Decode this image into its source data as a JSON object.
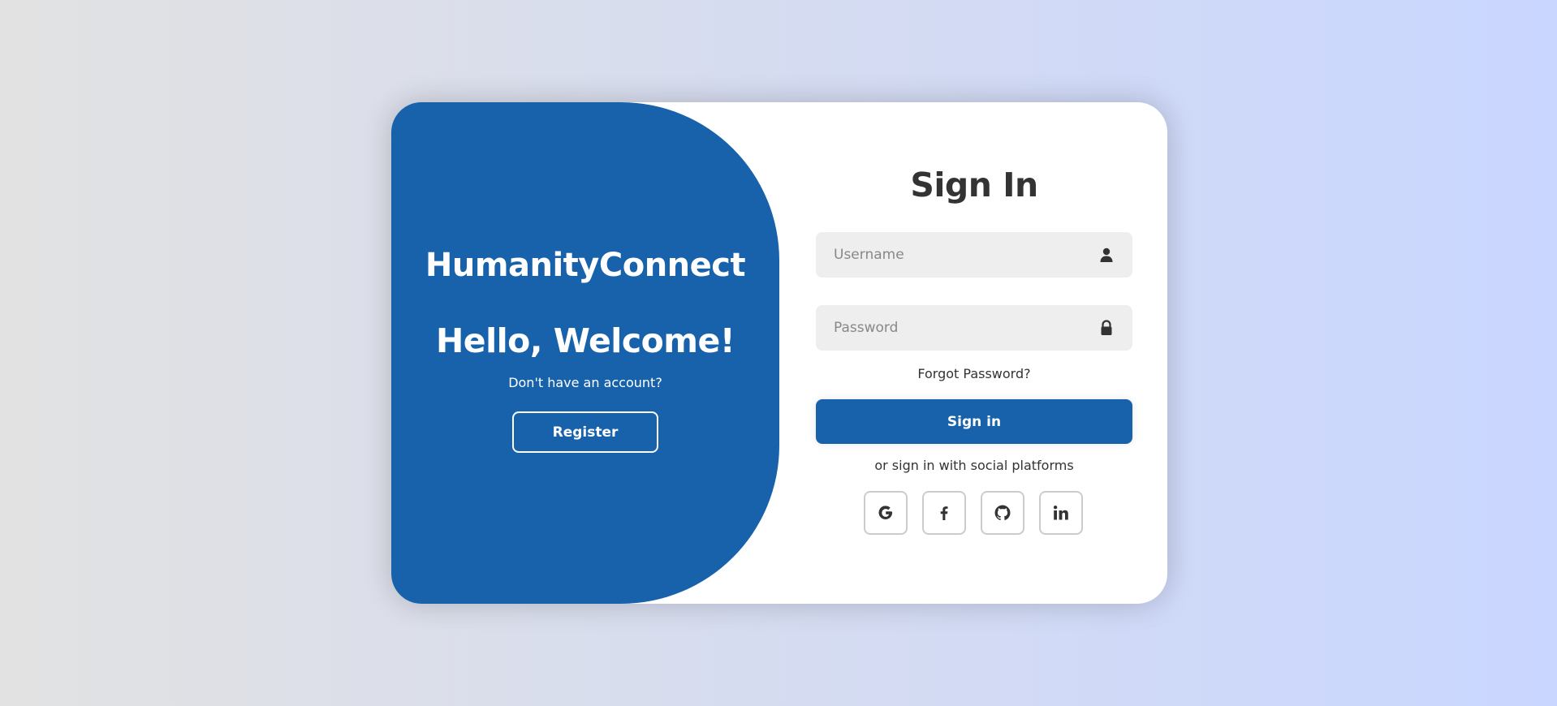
{
  "welcome_panel": {
    "brand": "HumanityConnect",
    "greeting": "Hello, Welcome!",
    "subtext": "Don't have an account?",
    "register_label": "Register"
  },
  "signin_form": {
    "title": "Sign In",
    "username": {
      "placeholder": "Username",
      "value": "",
      "icon": "user-icon"
    },
    "password": {
      "placeholder": "Password",
      "value": "",
      "icon": "lock-icon"
    },
    "forgot_label": "Forgot Password?",
    "submit_label": "Sign in",
    "social_text": "or sign in with social platforms",
    "social_icons": [
      "google-icon",
      "facebook-icon",
      "github-icon",
      "linkedin-icon"
    ]
  },
  "colors": {
    "primary": "#1862ab",
    "input_bg": "#eeeeee",
    "text": "#333333",
    "bg_gradient_start": "#e2e2e2",
    "bg_gradient_end": "#c9d6ff"
  }
}
